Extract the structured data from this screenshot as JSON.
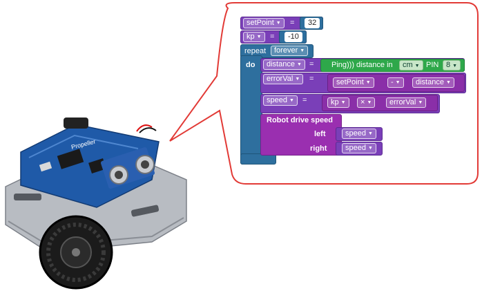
{
  "code": {
    "set_point": {
      "variable": "setPoint",
      "op": "=",
      "value": "32"
    },
    "kp": {
      "variable": "kp",
      "op": "=",
      "value": "-10"
    },
    "repeat": {
      "keyword": "repeat",
      "mode": "forever",
      "do_label": "do"
    },
    "distance": {
      "variable": "distance",
      "op": "=",
      "sensor_text": "Ping))) distance in",
      "unit": "cm",
      "pin_label": "PIN",
      "pin": "8"
    },
    "error_val": {
      "variable": "errorVal",
      "op": "=",
      "left": "setPoint",
      "operator": "-",
      "right": "distance"
    },
    "speed": {
      "variable": "speed",
      "op": "=",
      "left": "kp",
      "operator": "×",
      "right": "errorVal"
    },
    "drive": {
      "title": "Robot drive speed",
      "left_label": "left",
      "left_value": "speed",
      "right_label": "right",
      "right_value": "speed"
    }
  },
  "board_label": "Propeller"
}
